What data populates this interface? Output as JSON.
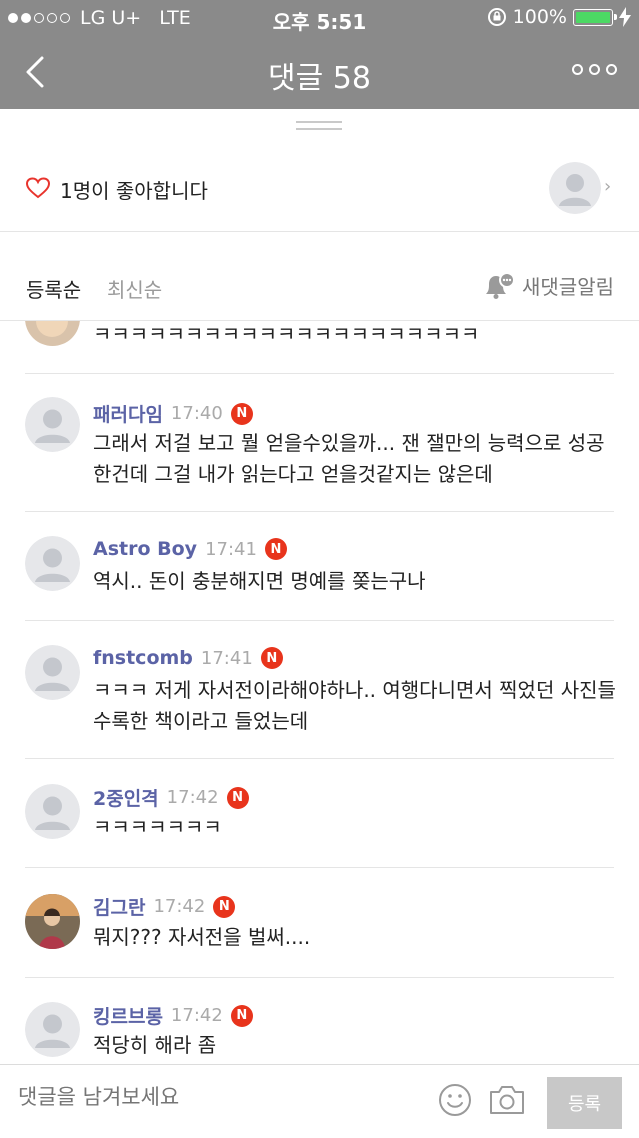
{
  "status_bar": {
    "carrier": "LG U+",
    "network": "LTE",
    "time": "오후 5:51",
    "battery": "100%"
  },
  "nav": {
    "title": "댓글 58"
  },
  "likes": {
    "text": "1명이 좋아합니다"
  },
  "sort": {
    "tabs": [
      "등록순",
      "최신순"
    ],
    "selected": "등록순",
    "alert_label": "새댓글알림"
  },
  "comments": [
    {
      "author": "",
      "time": "",
      "badge": "",
      "body": "ㅋㅋㅋㅋㅋㅋㅋㅋㅋㅋㅋㅋㅋㅋㅋㅋㅋㅋㅋㅋㅋ",
      "avatar": "photo"
    },
    {
      "author": "패러다임",
      "time": "17:40",
      "badge": "N",
      "body": "그래서 저걸 보고 뭘 얻을수있을까... 잰 잴만의 능력으로 성공한건데 그걸 내가 읽는다고 얻을것같지는 않은데",
      "avatar": "default"
    },
    {
      "author": "Astro Boy",
      "time": "17:41",
      "badge": "N",
      "body": "역시.. 돈이 충분해지면 명예를 쫒는구나",
      "avatar": "default"
    },
    {
      "author": "fnstcomb",
      "time": "17:41",
      "badge": "N",
      "body": "ㅋㅋㅋ 저게 자서전이라해야하나.. 여행다니면서 찍었던 사진들수록한 책이라고 들었는데",
      "avatar": "default"
    },
    {
      "author": "2중인격",
      "time": "17:42",
      "badge": "N",
      "body": "ㅋㅋㅋㅋㅋㅋㅋ",
      "avatar": "default"
    },
    {
      "author": "김그란",
      "time": "17:42",
      "badge": "N",
      "body": "뭐지??? 자서전을 벌써....",
      "avatar": "photo"
    },
    {
      "author": "킹르브롱",
      "time": "17:42",
      "badge": "N",
      "body": "적당히 해라 좀",
      "avatar": "default"
    }
  ],
  "input": {
    "placeholder": "댓글을 남겨보세요",
    "submit_label": "등록"
  },
  "colors": {
    "header_bg": "#8a8a8a",
    "author": "#5b63a6",
    "new_badge": "#e8341c",
    "heart": "#e8342d"
  }
}
